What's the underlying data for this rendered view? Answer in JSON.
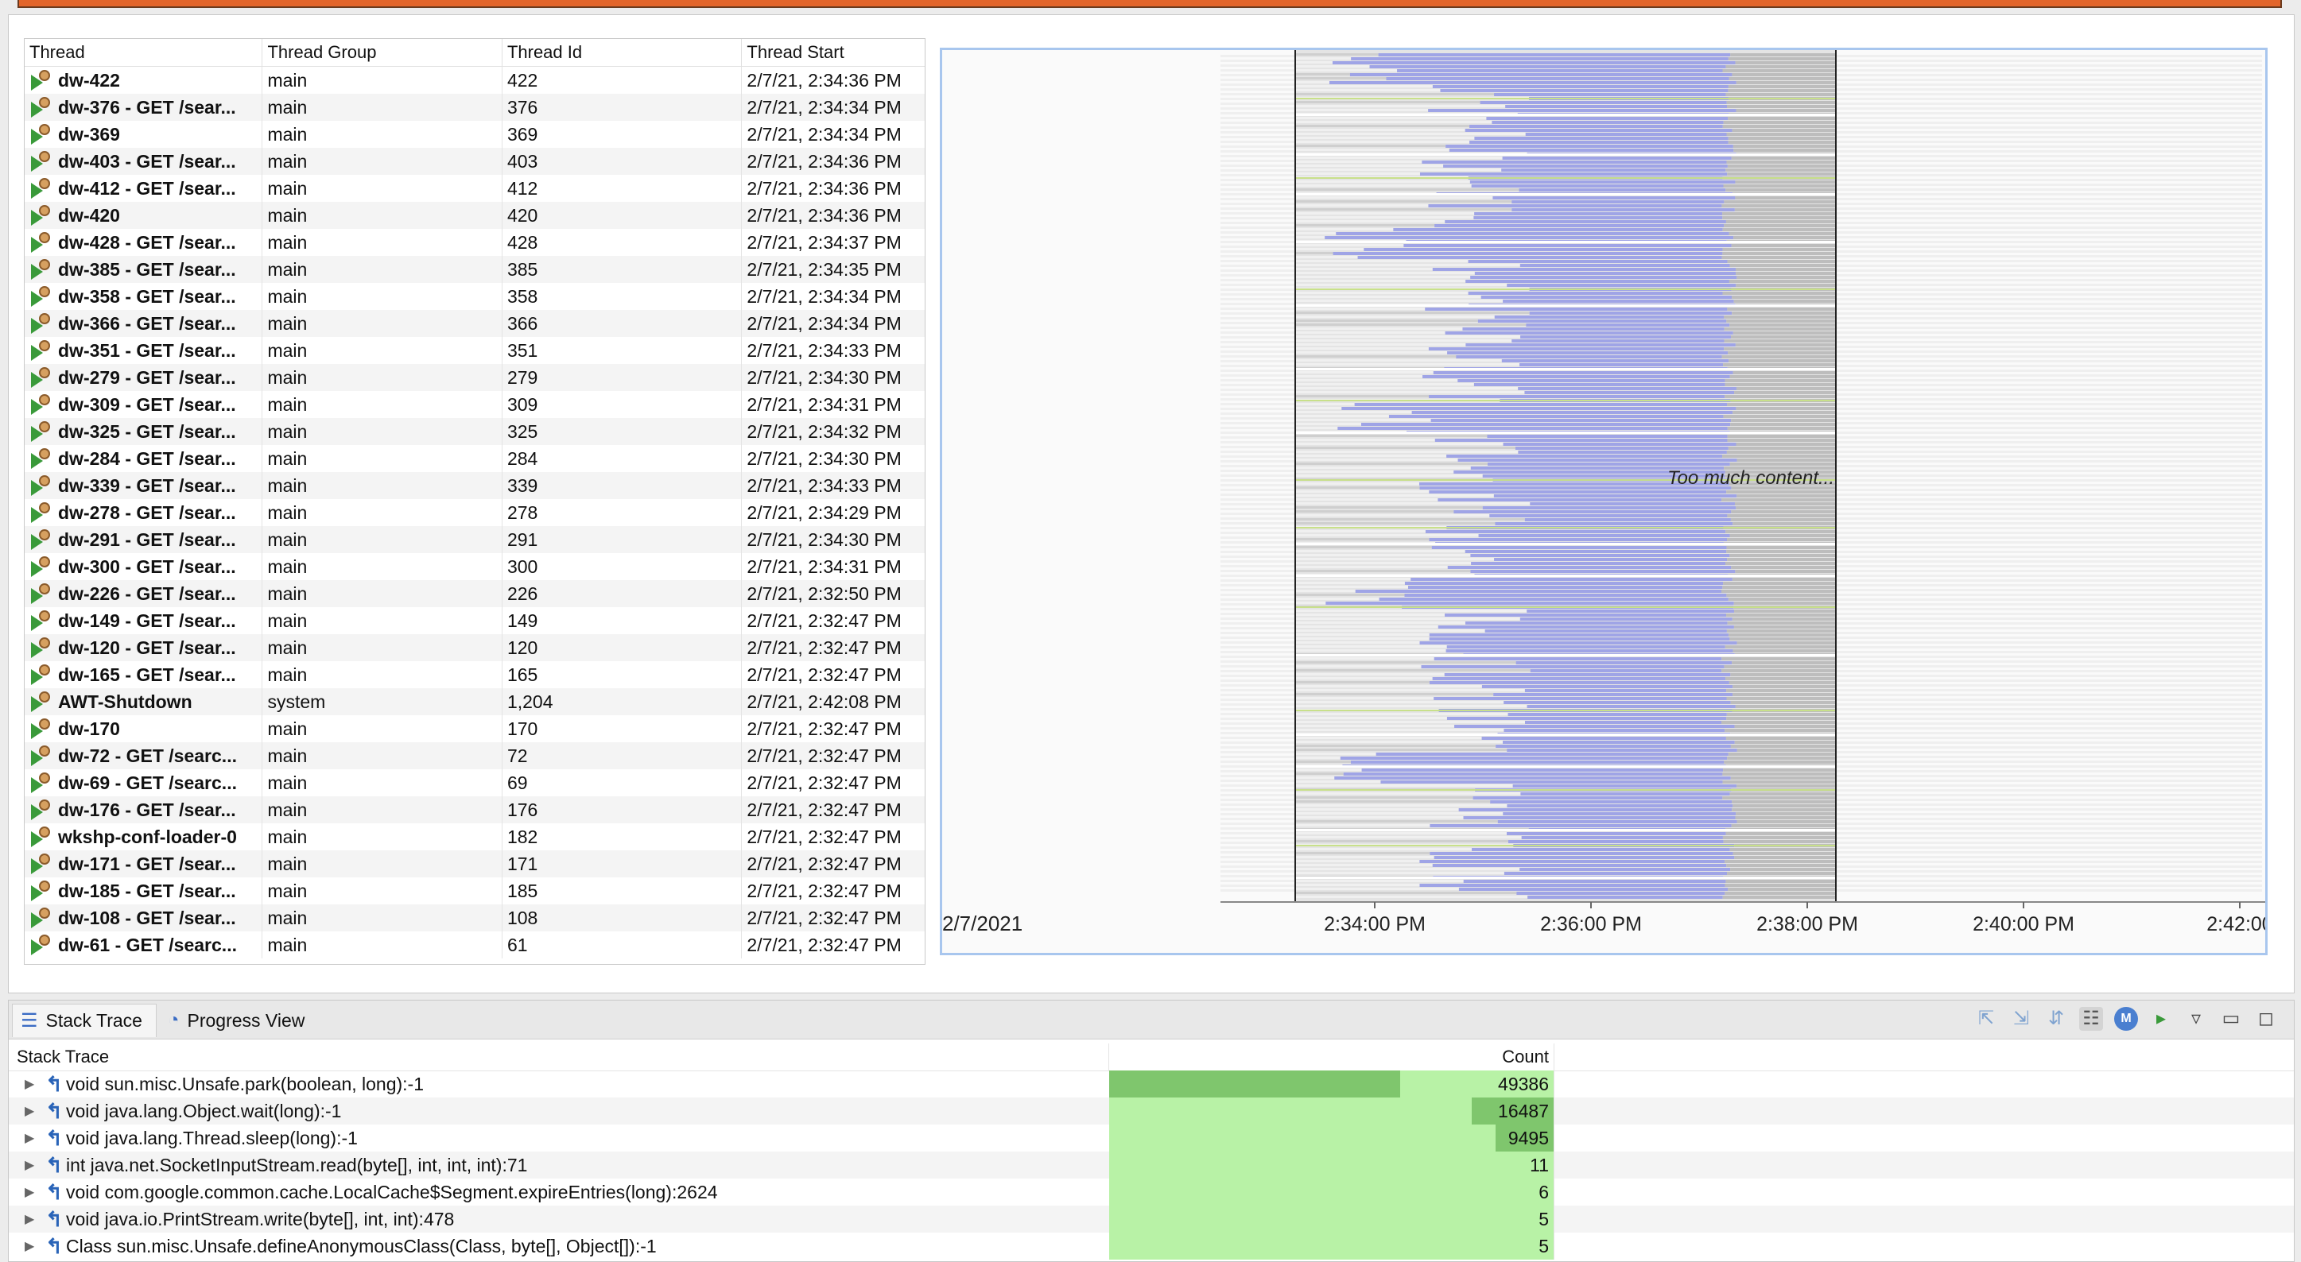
{
  "threads": {
    "headers": [
      "Thread",
      "Thread Group",
      "Thread Id",
      "Thread Start"
    ],
    "rows": [
      {
        "name": "dw-422",
        "group": "main",
        "id": "422",
        "start": "2/7/21, 2:34:36 PM"
      },
      {
        "name": "dw-376 - GET /sear...",
        "group": "main",
        "id": "376",
        "start": "2/7/21, 2:34:34 PM"
      },
      {
        "name": "dw-369",
        "group": "main",
        "id": "369",
        "start": "2/7/21, 2:34:34 PM"
      },
      {
        "name": "dw-403 - GET /sear...",
        "group": "main",
        "id": "403",
        "start": "2/7/21, 2:34:36 PM"
      },
      {
        "name": "dw-412 - GET /sear...",
        "group": "main",
        "id": "412",
        "start": "2/7/21, 2:34:36 PM"
      },
      {
        "name": "dw-420",
        "group": "main",
        "id": "420",
        "start": "2/7/21, 2:34:36 PM"
      },
      {
        "name": "dw-428 - GET /sear...",
        "group": "main",
        "id": "428",
        "start": "2/7/21, 2:34:37 PM"
      },
      {
        "name": "dw-385 - GET /sear...",
        "group": "main",
        "id": "385",
        "start": "2/7/21, 2:34:35 PM"
      },
      {
        "name": "dw-358 - GET /sear...",
        "group": "main",
        "id": "358",
        "start": "2/7/21, 2:34:34 PM"
      },
      {
        "name": "dw-366 - GET /sear...",
        "group": "main",
        "id": "366",
        "start": "2/7/21, 2:34:34 PM"
      },
      {
        "name": "dw-351 - GET /sear...",
        "group": "main",
        "id": "351",
        "start": "2/7/21, 2:34:33 PM"
      },
      {
        "name": "dw-279 - GET /sear...",
        "group": "main",
        "id": "279",
        "start": "2/7/21, 2:34:30 PM"
      },
      {
        "name": "dw-309 - GET /sear...",
        "group": "main",
        "id": "309",
        "start": "2/7/21, 2:34:31 PM"
      },
      {
        "name": "dw-325 - GET /sear...",
        "group": "main",
        "id": "325",
        "start": "2/7/21, 2:34:32 PM"
      },
      {
        "name": "dw-284 - GET /sear...",
        "group": "main",
        "id": "284",
        "start": "2/7/21, 2:34:30 PM"
      },
      {
        "name": "dw-339 - GET /sear...",
        "group": "main",
        "id": "339",
        "start": "2/7/21, 2:34:33 PM"
      },
      {
        "name": "dw-278 - GET /sear...",
        "group": "main",
        "id": "278",
        "start": "2/7/21, 2:34:29 PM"
      },
      {
        "name": "dw-291 - GET /sear...",
        "group": "main",
        "id": "291",
        "start": "2/7/21, 2:34:30 PM"
      },
      {
        "name": "dw-300 - GET /sear...",
        "group": "main",
        "id": "300",
        "start": "2/7/21, 2:34:31 PM"
      },
      {
        "name": "dw-226 - GET /sear...",
        "group": "main",
        "id": "226",
        "start": "2/7/21, 2:32:50 PM"
      },
      {
        "name": "dw-149 - GET /sear...",
        "group": "main",
        "id": "149",
        "start": "2/7/21, 2:32:47 PM"
      },
      {
        "name": "dw-120 - GET /sear...",
        "group": "main",
        "id": "120",
        "start": "2/7/21, 2:32:47 PM"
      },
      {
        "name": "dw-165 - GET /sear...",
        "group": "main",
        "id": "165",
        "start": "2/7/21, 2:32:47 PM"
      },
      {
        "name": "AWT-Shutdown",
        "group": "system",
        "id": "1,204",
        "start": "2/7/21, 2:42:08 PM"
      },
      {
        "name": "dw-170",
        "group": "main",
        "id": "170",
        "start": "2/7/21, 2:32:47 PM"
      },
      {
        "name": "dw-72 - GET /searc...",
        "group": "main",
        "id": "72",
        "start": "2/7/21, 2:32:47 PM"
      },
      {
        "name": "dw-69 - GET /searc...",
        "group": "main",
        "id": "69",
        "start": "2/7/21, 2:32:47 PM"
      },
      {
        "name": "dw-176 - GET /sear...",
        "group": "main",
        "id": "176",
        "start": "2/7/21, 2:32:47 PM"
      },
      {
        "name": "wkshp-conf-loader-0",
        "group": "main",
        "id": "182",
        "start": "2/7/21, 2:32:47 PM"
      },
      {
        "name": "dw-171 - GET /sear...",
        "group": "main",
        "id": "171",
        "start": "2/7/21, 2:32:47 PM"
      },
      {
        "name": "dw-185 - GET /sear...",
        "group": "main",
        "id": "185",
        "start": "2/7/21, 2:32:47 PM"
      },
      {
        "name": "dw-108 - GET /sear...",
        "group": "main",
        "id": "108",
        "start": "2/7/21, 2:32:47 PM"
      },
      {
        "name": "dw-61 - GET /searc...",
        "group": "main",
        "id": "61",
        "start": "2/7/21, 2:32:47 PM"
      }
    ]
  },
  "timeline": {
    "date_label": "2/7/2021",
    "ticks": [
      "2:34:00 PM",
      "2:36:00 PM",
      "2:38:00 PM",
      "2:40:00 PM",
      "2:42:00"
    ],
    "overlay_text": "Too much content...",
    "colors": {
      "activity": "#9fa4e6",
      "idle": "#bdbdbd",
      "light": "#e4e4e4",
      "accent": "#c8e08a"
    }
  },
  "bottom": {
    "tabs": [
      {
        "label": "Stack Trace",
        "icon": "list-icon"
      },
      {
        "label": "Progress View",
        "icon": "progress-icon"
      }
    ],
    "headers": {
      "trace": "Stack Trace",
      "count": "Count"
    },
    "rows": [
      {
        "frame": "void sun.misc.Unsafe.park(boolean, long):-1",
        "count": "49386",
        "count_value": 49386
      },
      {
        "frame": "void java.lang.Object.wait(long):-1",
        "count": "16487",
        "count_value": 16487
      },
      {
        "frame": "void java.lang.Thread.sleep(long):-1",
        "count": "9495",
        "count_value": 9495
      },
      {
        "frame": "int java.net.SocketInputStream.read(byte[], int, int, int):71",
        "count": "11",
        "count_value": 11
      },
      {
        "frame": "void com.google.common.cache.LocalCache$Segment.expireEntries(long):2624",
        "count": "6",
        "count_value": 6
      },
      {
        "frame": "void java.io.PrintStream.write(byte[], int, int):478",
        "count": "5",
        "count_value": 5
      },
      {
        "frame": "Class sun.misc.Unsafe.defineAnonymousClass(Class, byte[], Object[]):-1",
        "count": "5",
        "count_value": 5
      }
    ],
    "toolbar_icons": [
      "filter-icon",
      "group-icon",
      "sort-icon",
      "tree-icon",
      "method-icon",
      "thread-icon",
      "menu-icon",
      "minimize-icon",
      "maximize-icon"
    ]
  }
}
